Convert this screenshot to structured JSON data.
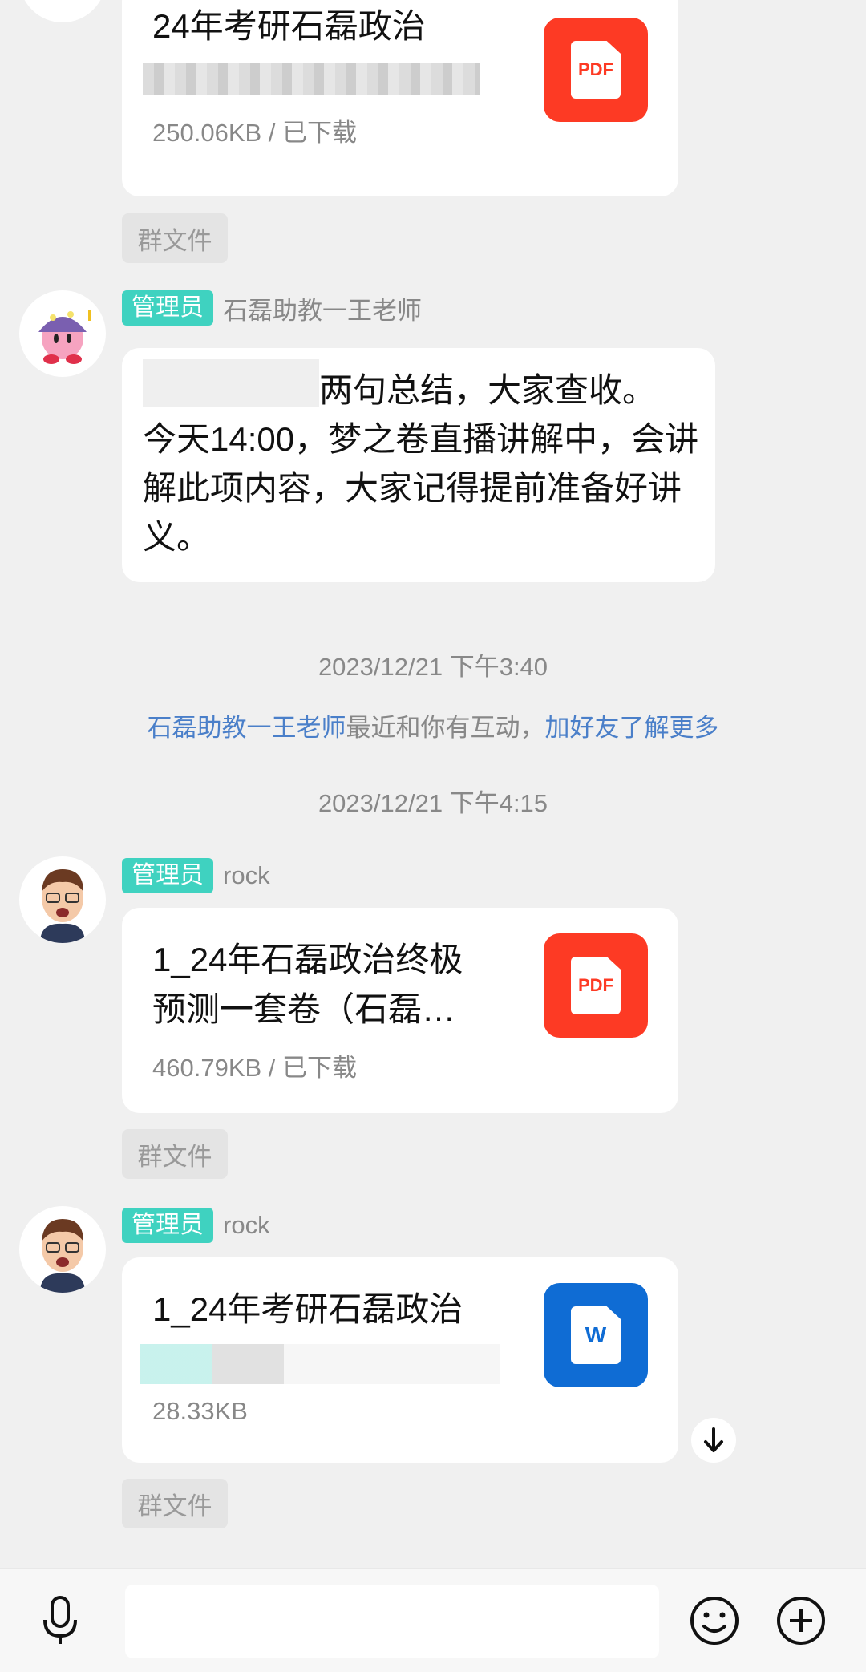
{
  "messages": [
    {
      "file_title": "24年考研石磊政治",
      "file_meta": "250.06KB / 已下载",
      "file_type": "PDF",
      "tag": "群文件"
    },
    {
      "badge": "管理员",
      "sender": "石磊助教一王老师",
      "text_line1_visible": "两句总结，大家查收。",
      "text_rest": "今天14:00，梦之卷直播讲解中，会讲解此项内容，大家记得提前准备好讲义。"
    },
    {
      "badge": "管理员",
      "sender": "rock",
      "file_title_line1": "1_24年石磊政治终极",
      "file_title_line2": "预测一套卷（石磊…",
      "file_meta": "460.79KB / 已下载",
      "file_type": "PDF",
      "tag": "群文件"
    },
    {
      "badge": "管理员",
      "sender": "rock",
      "file_title_line1": "1_24年考研石磊政治",
      "file_meta": "28.33KB",
      "file_type": "W",
      "tag": "群文件"
    }
  ],
  "timestamps": [
    "2023/12/21 下午3:40",
    "2023/12/21 下午4:15"
  ],
  "notice": {
    "link_name": "石磊助教一王老师",
    "middle": "最近和你有互动，",
    "link_action": "加好友了解更多"
  },
  "icons": {
    "voice": "microphone-icon",
    "emoji": "smiley-icon",
    "plus": "plus-circle-icon",
    "scroll": "arrow-down-icon"
  },
  "colors": {
    "badge": "#3fd2c0",
    "pdf": "#fd3a24",
    "word": "#0f6cd4",
    "link": "#4a7fc9"
  }
}
